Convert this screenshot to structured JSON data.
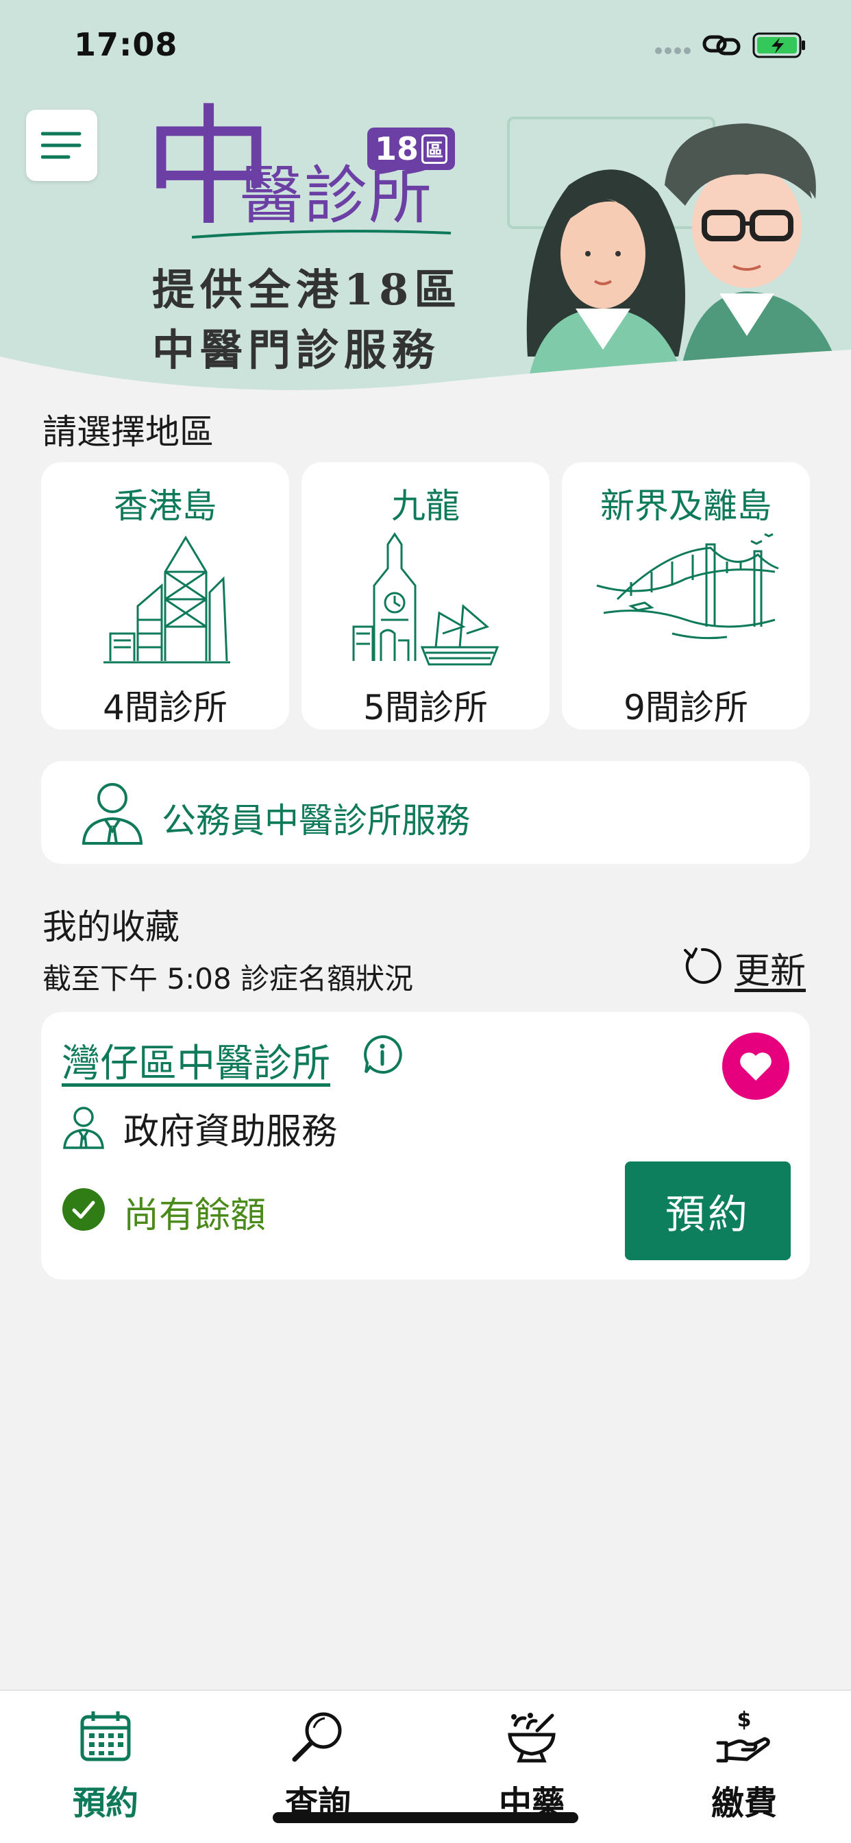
{
  "status_bar": {
    "time": "17:08"
  },
  "header": {
    "logo_main": "中",
    "logo_name": "醫診所",
    "logo_badge_number": "18",
    "logo_badge_suffix": "區",
    "tagline_line1": "提供全港18區",
    "tagline_line2": "中醫門診服務"
  },
  "regions": {
    "title": "請選擇地區",
    "items": [
      {
        "name": "香港島",
        "count": "4間診所",
        "icon": "skyscraper-illustration"
      },
      {
        "name": "九龍",
        "count": "5間診所",
        "icon": "clock-tower-illustration"
      },
      {
        "name": "新界及離島",
        "count": "9間診所",
        "icon": "bridge-illustration"
      }
    ]
  },
  "civil_service": {
    "label": "公務員中醫診所服務",
    "icon": "civil-servant-icon"
  },
  "favorites": {
    "title": "我的收藏",
    "subtitle": "截至下午 5:08 診症名額狀況",
    "refresh_label": "更新",
    "clinic": {
      "name": "灣仔區中醫診所",
      "service": "政府資助服務",
      "quota_status": "尚有餘額",
      "book_label": "預約",
      "favorited": true
    }
  },
  "bottom_nav": {
    "items": [
      {
        "label": "預約",
        "icon": "calendar-icon",
        "active": true
      },
      {
        "label": "查詢",
        "icon": "search-icon",
        "active": false
      },
      {
        "label": "中藥",
        "icon": "herb-bowl-icon",
        "active": false
      },
      {
        "label": "繳費",
        "icon": "payment-hand-icon",
        "active": false
      }
    ]
  },
  "colors": {
    "brand_green": "#0f7a5a",
    "hero_bg": "#cce3dc",
    "logo_purple": "#6b3fa3",
    "heart_pink": "#e6007e",
    "quota_green": "#4a8a1a"
  }
}
